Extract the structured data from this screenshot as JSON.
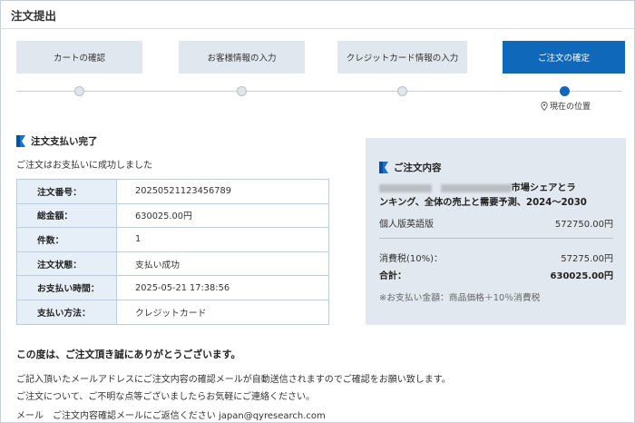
{
  "page": {
    "title": "注文提出"
  },
  "steps": [
    {
      "label": "カートの確認",
      "active": false
    },
    {
      "label": "お客様情報の入力",
      "active": false
    },
    {
      "label": "クレジットカード情報の入力",
      "active": false
    },
    {
      "label": "ご注文の確定",
      "active": true
    }
  ],
  "current_position_label": "現在の位置",
  "completion": {
    "heading": "注文支払い完了",
    "message": "ご注文はお支払いに成功しました",
    "rows": [
      {
        "key": "注文番号：",
        "value": "20250521123456789"
      },
      {
        "key": "総金額：",
        "value": "630025.00円"
      },
      {
        "key": "件数：",
        "value": "1"
      },
      {
        "key": "注文状態：",
        "value": "支払い成功"
      },
      {
        "key": "お支払い時間：",
        "value": "2025-05-21  17:38:56"
      },
      {
        "key": "支払い方法：",
        "value": "クレジットカード"
      }
    ]
  },
  "summary": {
    "heading": "ご注文内容",
    "product_line1": "市場シェアとラ",
    "product_line2": "ンキング、全体の売上と需要予測、2024～2030",
    "edition": "個人版英語版",
    "edition_price": "572750.00円",
    "tax_label": "消費税(10%)：",
    "tax_value": "57275.00円",
    "total_label": "合計：",
    "total_value": "630025.00円",
    "note": "※お支払い金額：商品価格＋10％消費税"
  },
  "footer": {
    "thanks": "この度は、ご注文頂き誠にありがとうございます。",
    "line1": "ご記入頂いたメールアドレスにご注文内容の確認メールが自動送信されますのでご確認をお願い致します。",
    "line2": "ご注文について、ご不明な点等ございましたらお気軽にご連絡ください。",
    "line3": "メール　ご注文内容確認メールにご返信ください japan@qyresearch.com"
  },
  "colors": {
    "accent": "#1068ba",
    "step_inactive": "#e1e7ee",
    "summary_bg": "#e2e8ef",
    "table_key_bg": "#e6eef8"
  }
}
